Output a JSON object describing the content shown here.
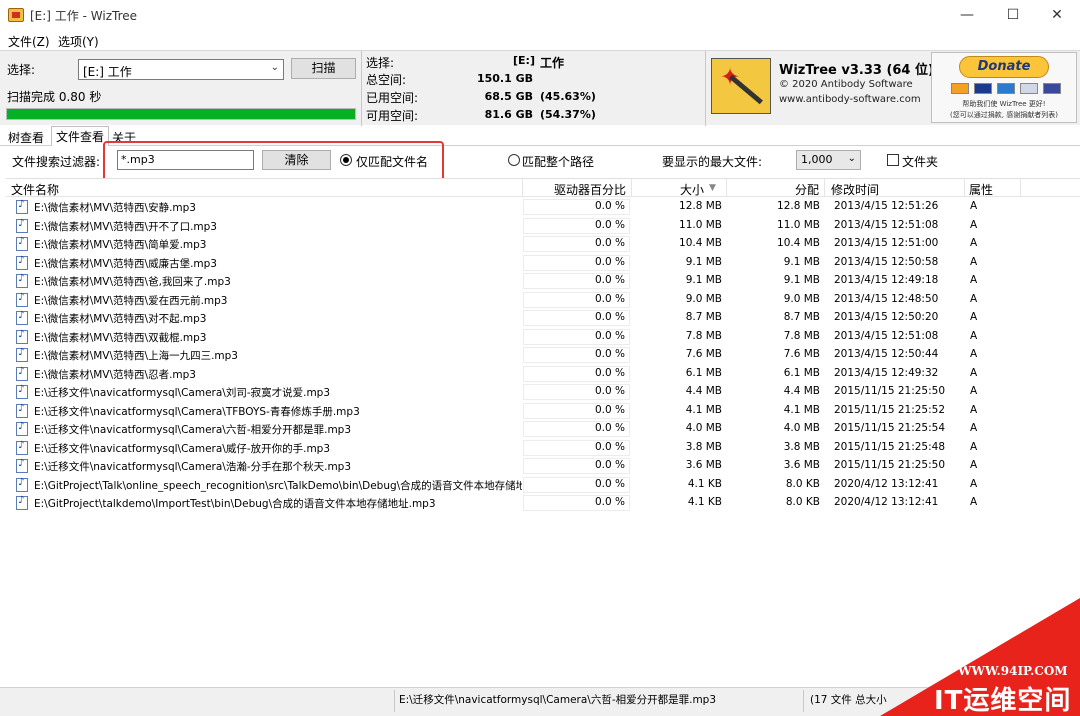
{
  "window": {
    "title": "[E:] 工作  - WizTree",
    "minimize": "—",
    "maximize": "☐",
    "close": "✕"
  },
  "menu": [
    "文件(Z)",
    "选项(Y)"
  ],
  "scan": {
    "select_label": "选择:",
    "drive_value": "[E:] 工作",
    "scan_button": "扫描",
    "status": "扫描完成 0.80 秒",
    "progress": 1.0
  },
  "stats": {
    "select_label": "选择:",
    "drive": "[E:]",
    "drive_name": "工作",
    "total_label": "总空间:",
    "total_value": "150.1 GB",
    "used_label": "已用空间:",
    "used_value": "68.5 GB",
    "used_pct": "(45.63%)",
    "free_label": "可用空间:",
    "free_value": "81.6 GB",
    "free_pct": "(54.37%)"
  },
  "brand": {
    "title": "WizTree v3.33 (64 位)",
    "copyright": "© 2020 Antibody Software",
    "url": "www.antibody-software.com",
    "donate": "Donate",
    "note1": "帮助我们使 WizTree 更好!",
    "note2": "(您可以通过捐款, 感谢捐献者列表)"
  },
  "tabs": [
    "树查看",
    "文件查看",
    "关于"
  ],
  "filter": {
    "label": "文件搜索过滤器:",
    "value": "*.mp3",
    "clear_button": "清除",
    "match_name": "仅匹配文件名",
    "match_path": "匹配整个路径",
    "max_label": "要显示的最大文件:",
    "max_value": "1,000",
    "folder_label": "文件夹"
  },
  "columns": {
    "name": "文件名称",
    "pct": "驱动器百分比",
    "size": "大小",
    "alloc": "分配",
    "modified": "修改时间",
    "attr": "属性"
  },
  "rows": [
    {
      "name": "E:\\微信素材\\MV\\范特西\\安静.mp3",
      "pct": "0.0 %",
      "size": "12.8 MB",
      "alloc": "12.8 MB",
      "modified": "2013/4/15 12:51:26",
      "attr": "A"
    },
    {
      "name": "E:\\微信素材\\MV\\范特西\\开不了口.mp3",
      "pct": "0.0 %",
      "size": "11.0 MB",
      "alloc": "11.0 MB",
      "modified": "2013/4/15 12:51:08",
      "attr": "A"
    },
    {
      "name": "E:\\微信素材\\MV\\范特西\\简单爱.mp3",
      "pct": "0.0 %",
      "size": "10.4 MB",
      "alloc": "10.4 MB",
      "modified": "2013/4/15 12:51:00",
      "attr": "A"
    },
    {
      "name": "E:\\微信素材\\MV\\范特西\\威廉古堡.mp3",
      "pct": "0.0 %",
      "size": "9.1 MB",
      "alloc": "9.1 MB",
      "modified": "2013/4/15 12:50:58",
      "attr": "A"
    },
    {
      "name": "E:\\微信素材\\MV\\范特西\\爸,我回来了.mp3",
      "pct": "0.0 %",
      "size": "9.1 MB",
      "alloc": "9.1 MB",
      "modified": "2013/4/15 12:49:18",
      "attr": "A"
    },
    {
      "name": "E:\\微信素材\\MV\\范特西\\爱在西元前.mp3",
      "pct": "0.0 %",
      "size": "9.0 MB",
      "alloc": "9.0 MB",
      "modified": "2013/4/15 12:48:50",
      "attr": "A"
    },
    {
      "name": "E:\\微信素材\\MV\\范特西\\对不起.mp3",
      "pct": "0.0 %",
      "size": "8.7 MB",
      "alloc": "8.7 MB",
      "modified": "2013/4/15 12:50:20",
      "attr": "A"
    },
    {
      "name": "E:\\微信素材\\MV\\范特西\\双截棍.mp3",
      "pct": "0.0 %",
      "size": "7.8 MB",
      "alloc": "7.8 MB",
      "modified": "2013/4/15 12:51:08",
      "attr": "A"
    },
    {
      "name": "E:\\微信素材\\MV\\范特西\\上海一九四三.mp3",
      "pct": "0.0 %",
      "size": "7.6 MB",
      "alloc": "7.6 MB",
      "modified": "2013/4/15 12:50:44",
      "attr": "A"
    },
    {
      "name": "E:\\微信素材\\MV\\范特西\\忍者.mp3",
      "pct": "0.0 %",
      "size": "6.1 MB",
      "alloc": "6.1 MB",
      "modified": "2013/4/15 12:49:32",
      "attr": "A"
    },
    {
      "name": "E:\\迁移文件\\navicatformysql\\Camera\\刘司-寂寞才说爱.mp3",
      "pct": "0.0 %",
      "size": "4.4 MB",
      "alloc": "4.4 MB",
      "modified": "2015/11/15 21:25:50",
      "attr": "A"
    },
    {
      "name": "E:\\迁移文件\\navicatformysql\\Camera\\TFBOYS-青春修炼手册.mp3",
      "pct": "0.0 %",
      "size": "4.1 MB",
      "alloc": "4.1 MB",
      "modified": "2015/11/15 21:25:52",
      "attr": "A"
    },
    {
      "name": "E:\\迁移文件\\navicatformysql\\Camera\\六哲-相爱分开都是罪.mp3",
      "pct": "0.0 %",
      "size": "4.0 MB",
      "alloc": "4.0 MB",
      "modified": "2015/11/15 21:25:54",
      "attr": "A"
    },
    {
      "name": "E:\\迁移文件\\navicatformysql\\Camera\\威仔-放开你的手.mp3",
      "pct": "0.0 %",
      "size": "3.8 MB",
      "alloc": "3.8 MB",
      "modified": "2015/11/15 21:25:48",
      "attr": "A"
    },
    {
      "name": "E:\\迁移文件\\navicatformysql\\Camera\\浩瀚-分手在那个秋天.mp3",
      "pct": "0.0 %",
      "size": "3.6 MB",
      "alloc": "3.6 MB",
      "modified": "2015/11/15 21:25:50",
      "attr": "A"
    },
    {
      "name": "E:\\GitProject\\Talk\\online_speech_recognition\\src\\TalkDemo\\bin\\Debug\\合成的语音文件本地存储地址",
      "pct": "0.0 %",
      "size": "4.1 KB",
      "alloc": "8.0 KB",
      "modified": "2020/4/12 13:12:41",
      "attr": "A"
    },
    {
      "name": "E:\\GitProject\\talkdemo\\ImportTest\\bin\\Debug\\合成的语音文件本地存储地址.mp3",
      "pct": "0.0 %",
      "size": "4.1 KB",
      "alloc": "8.0 KB",
      "modified": "2020/4/12 13:12:41",
      "attr": "A"
    }
  ],
  "status": {
    "path": "E:\\迁移文件\\navicatformysql\\Camera\\六哲-相爱分开都是罪.mp3",
    "count": "(17 文件  总大小"
  },
  "watermark": {
    "url": "WWW.94IP.COM",
    "text": "IT运维空间"
  }
}
